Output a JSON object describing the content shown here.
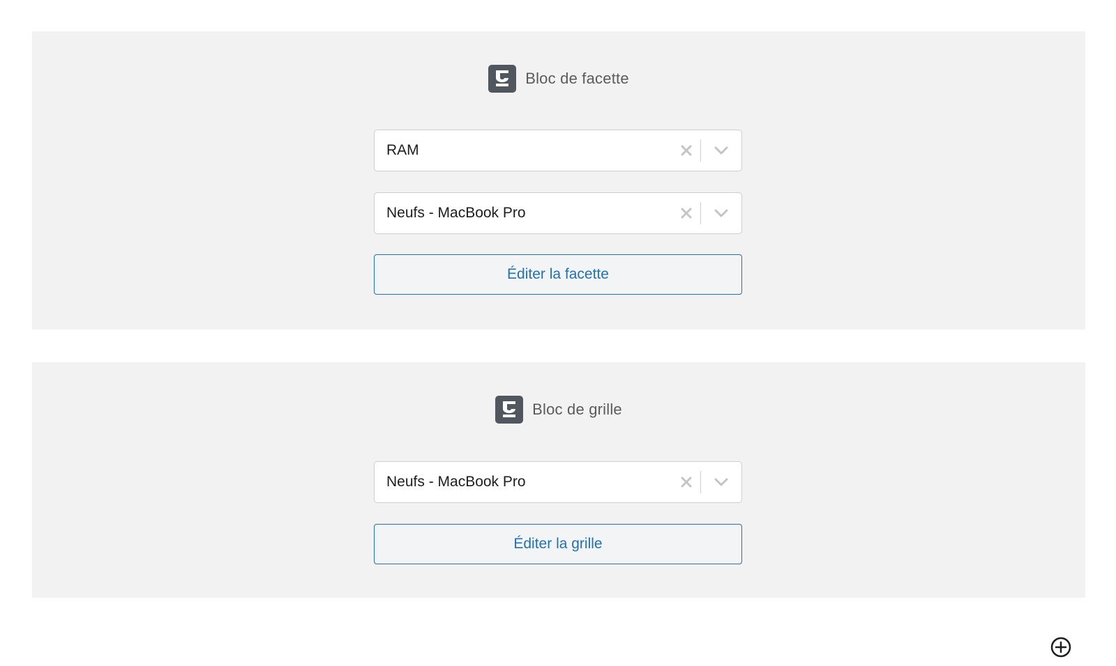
{
  "facet_block": {
    "title": "Bloc de facette",
    "icon": "wp-grid-builder-logo-icon",
    "facet_select": {
      "value": "RAM"
    },
    "grid_select": {
      "value": "Neufs - MacBook Pro"
    },
    "edit_label": "Éditer la facette"
  },
  "grid_block": {
    "title": "Bloc de grille",
    "icon": "wp-grid-builder-logo-icon",
    "grid_select": {
      "value": "Neufs - MacBook Pro"
    },
    "edit_label": "Éditer la grille"
  },
  "icons": {
    "clear": "close-icon",
    "dropdown": "chevron-down-icon",
    "add": "plus-circle-icon"
  },
  "colors": {
    "accent": "#2271b1",
    "block_bg": "#f2f2f2",
    "logo_bg": "#50575e"
  }
}
